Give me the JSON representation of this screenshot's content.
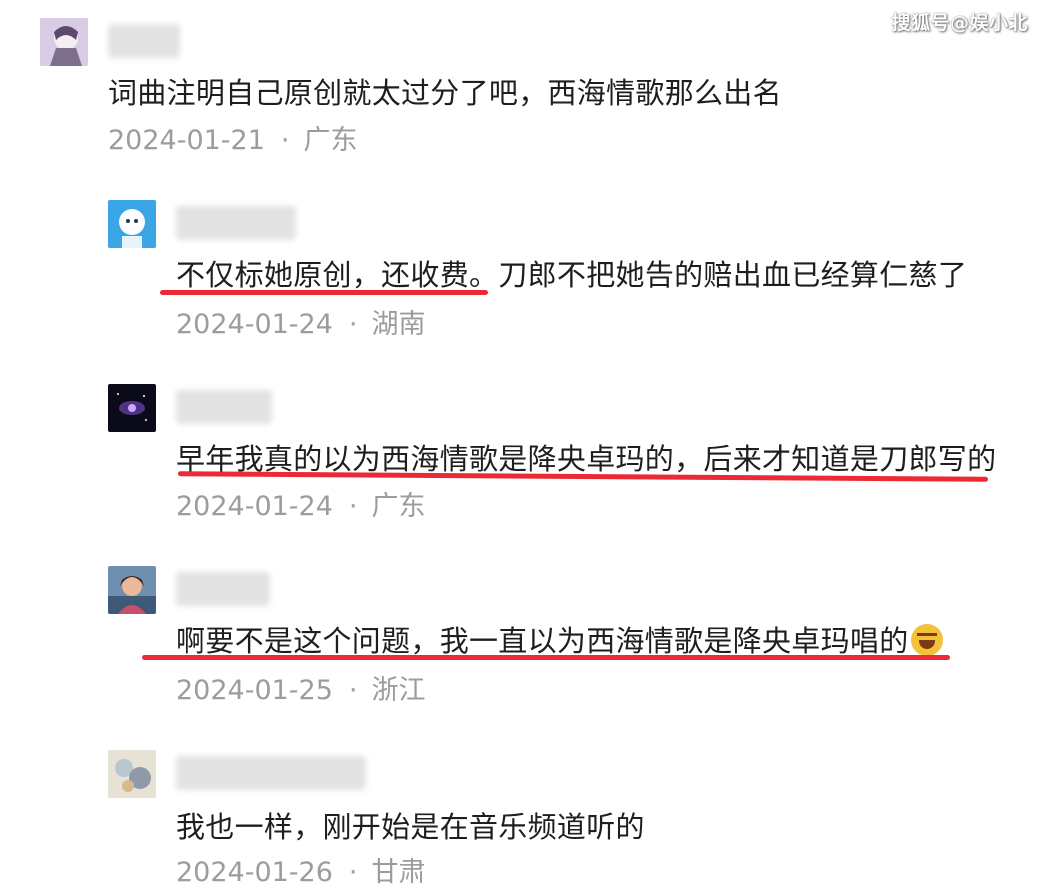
{
  "watermark": "搜狐号@娱小北",
  "comments": [
    {
      "text": "词曲注明自己原创就太过分了吧，西海情歌那么出名",
      "date": "2024-01-21",
      "dot": "·",
      "location": "广东",
      "avatar_icon": "anime-avatar-icon"
    },
    {
      "text_underlined": "不仅标她原创，还收费。",
      "text_rest": "刀郎不把她告的赔出血已经算仁慈了",
      "date": "2024-01-24",
      "dot": "·",
      "location": "湖南",
      "avatar_icon": "astronaut-dog-avatar-icon"
    },
    {
      "text": "早年我真的以为西海情歌是降央卓玛的，后来才知道是刀郎写的",
      "date": "2024-01-24",
      "dot": "·",
      "location": "广东",
      "avatar_icon": "galaxy-avatar-icon"
    },
    {
      "text": "啊要不是这个问题，我一直以为西海情歌是降央卓玛唱的",
      "emoji": "rolling-laughing-emoji",
      "date": "2024-01-25",
      "dot": "·",
      "location": "浙江",
      "avatar_icon": "portrait-avatar-icon"
    },
    {
      "text": "我也一样，刚开始是在音乐频道听的",
      "date": "2024-01-26",
      "dot": "·",
      "location": "甘肃",
      "avatar_icon": "floral-avatar-icon"
    }
  ],
  "colors": {
    "underline": "#ec2a36",
    "meta_text": "#9c9c9c",
    "content_text": "#1e1e1e"
  }
}
